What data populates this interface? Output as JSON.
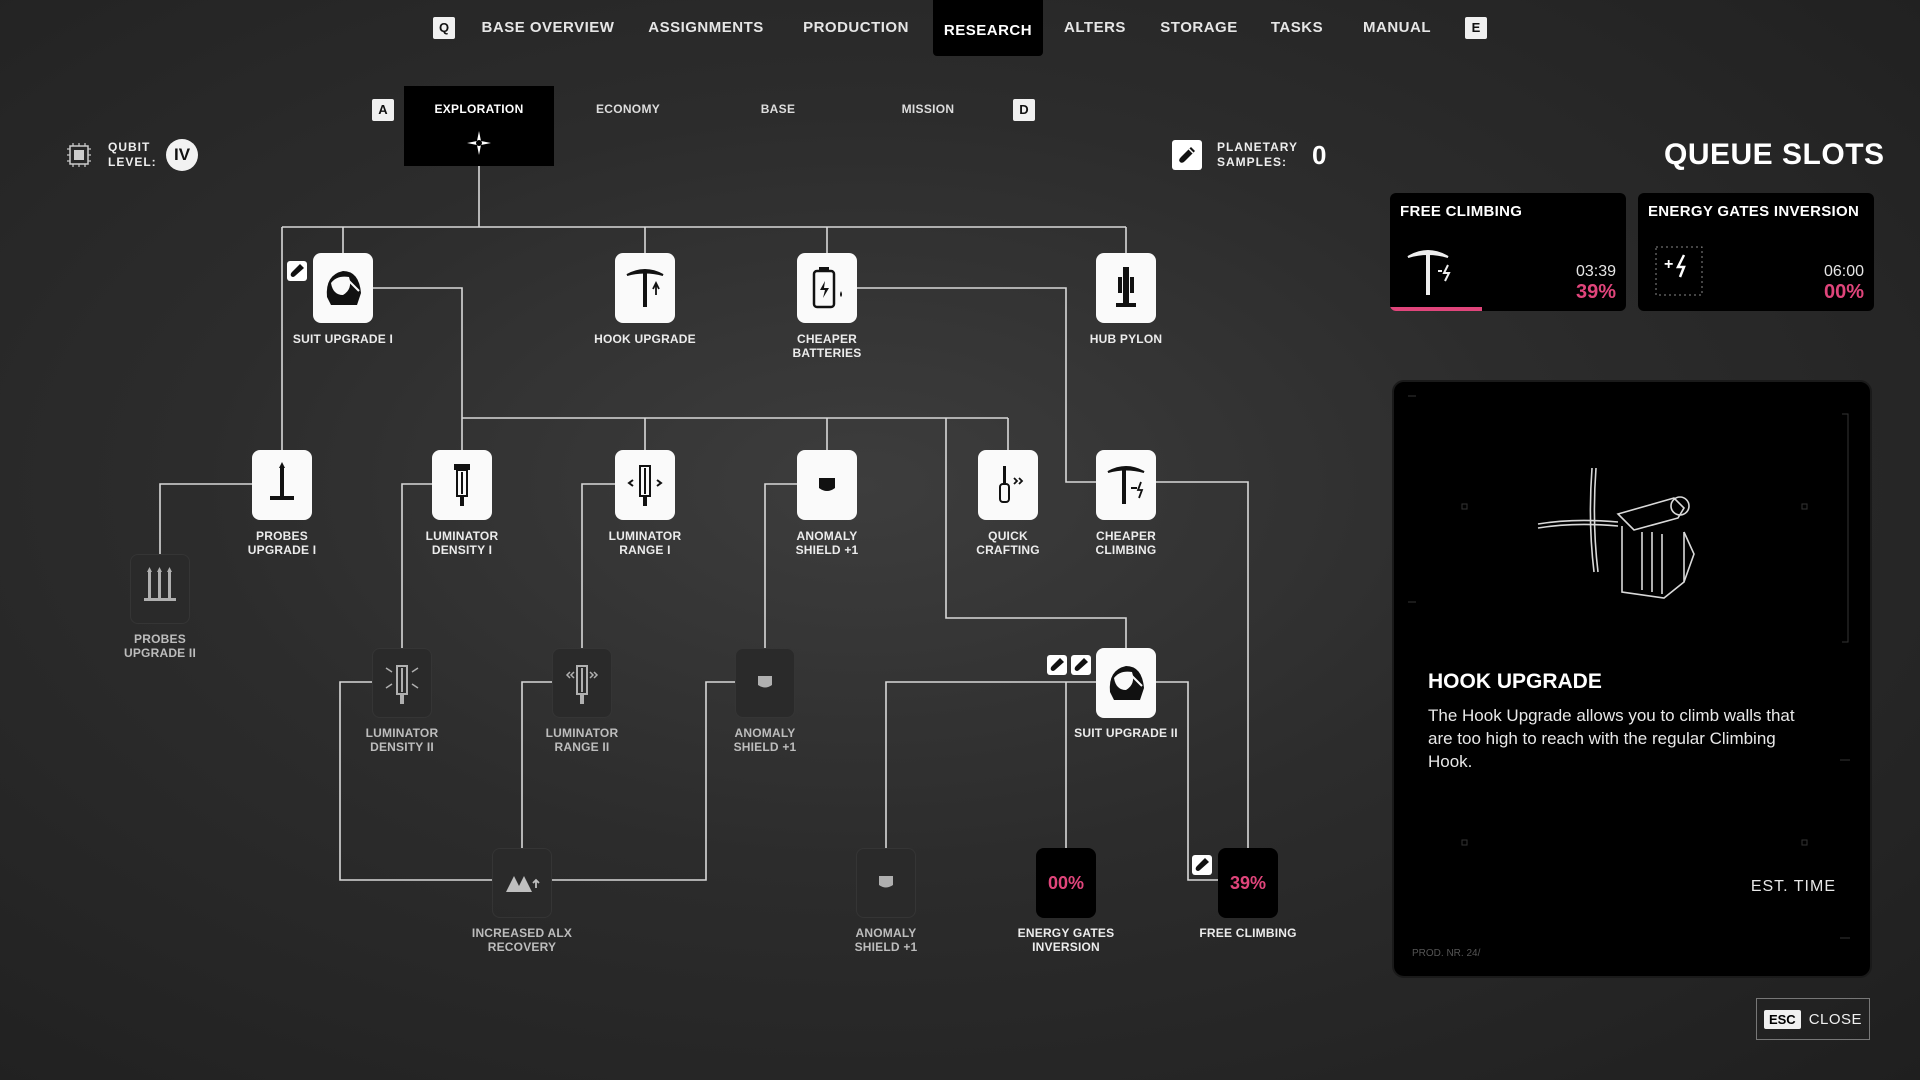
{
  "nav": {
    "left_key": "Q",
    "right_key": "E",
    "tabs": [
      "BASE OVERVIEW",
      "ASSIGNMENTS",
      "PRODUCTION",
      "RESEARCH",
      "ALTERS",
      "STORAGE",
      "TASKS",
      "MANUAL"
    ],
    "active": "RESEARCH"
  },
  "subnav": {
    "left_key": "A",
    "right_key": "D",
    "tabs": [
      "EXPLORATION",
      "ECONOMY",
      "BASE",
      "MISSION"
    ],
    "active": "EXPLORATION"
  },
  "qubit": {
    "label_line1": "QUBIT",
    "label_line2": "LEVEL:",
    "level": "IV"
  },
  "samples": {
    "label_line1": "PLANETARY",
    "label_line2": "SAMPLES:",
    "count": "0"
  },
  "tree": {
    "nodes": {
      "suit_upgrade_1": "SUIT UPGRADE I",
      "hook_upgrade": "HOOK UPGRADE",
      "cheaper_batteries_1": "CHEAPER",
      "cheaper_batteries_2": "BATTERIES",
      "hub_pylon": "HUB PYLON",
      "probes_upgrade_1_a": "PROBES",
      "probes_upgrade_1_b": "UPGRADE I",
      "luminator_density_1_a": "LUMINATOR",
      "luminator_density_1_b": "DENSITY I",
      "luminator_range_1_a": "LUMINATOR",
      "luminator_range_1_b": "RANGE I",
      "anomaly_shield_1_a": "ANOMALY",
      "anomaly_shield_1_b": "SHIELD +1",
      "quick_crafting_a": "QUICK",
      "quick_crafting_b": "CRAFTING",
      "cheaper_climbing_a": "CHEAPER",
      "cheaper_climbing_b": "CLIMBING",
      "probes_upgrade_2_a": "PROBES",
      "probes_upgrade_2_b": "UPGRADE II",
      "luminator_density_2_a": "LUMINATOR",
      "luminator_density_2_b": "DENSITY II",
      "luminator_range_2_a": "LUMINATOR",
      "luminator_range_2_b": "RANGE II",
      "anomaly_shield_2_a": "ANOMALY",
      "anomaly_shield_2_b": "SHIELD +1",
      "suit_upgrade_2": "SUIT UPGRADE II",
      "increased_alx_a": "INCREASED ALX",
      "increased_alx_b": "RECOVERY",
      "anomaly_shield_3_a": "ANOMALY",
      "anomaly_shield_3_b": "SHIELD +1",
      "energy_gates_a": "ENERGY GATES",
      "energy_gates_b": "INVERSION",
      "energy_gates_pct": "00%",
      "free_climbing": "FREE CLIMBING",
      "free_climbing_pct": "39%"
    }
  },
  "queue": {
    "title": "QUEUE SLOTS",
    "slots": [
      {
        "name": "FREE CLIMBING",
        "time": "03:39",
        "pct": "39%",
        "progress": 0.39,
        "icon": "pickaxe-icon"
      },
      {
        "name": "ENERGY GATES INVERSION",
        "time": "06:00",
        "pct": "00%",
        "progress": 0.0,
        "icon": "energy-gate-icon"
      }
    ]
  },
  "detail": {
    "title": "HOOK UPGRADE",
    "description": "The Hook Upgrade allows you to climb walls that are too high to reach with the regular Climbing Hook.",
    "est_label": "EST. TIME",
    "prod_label": "PROD. NR. 24/"
  },
  "close": {
    "key": "ESC",
    "label": "CLOSE"
  },
  "colors": {
    "accent": "#e0457b",
    "panel": "#000000",
    "node_white": "#fafafa"
  }
}
